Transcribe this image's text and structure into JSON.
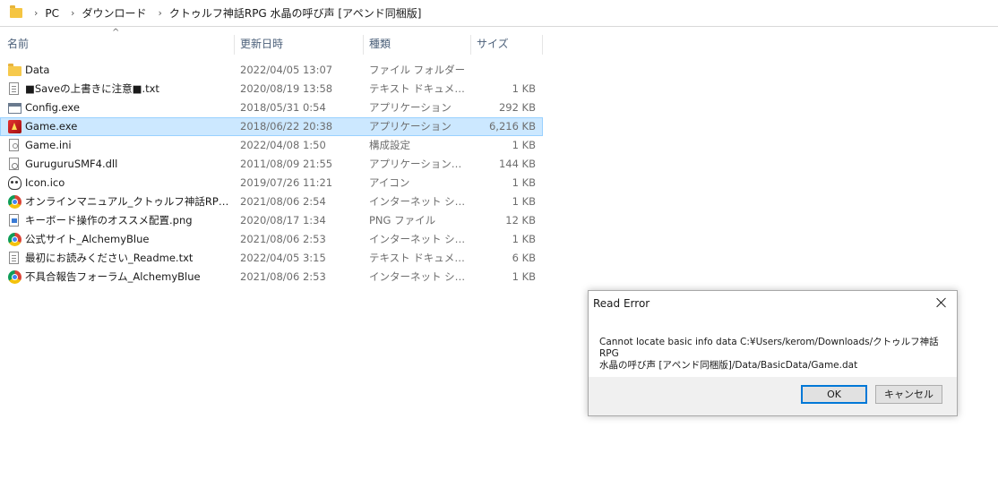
{
  "address_bar": {
    "folder_icon": "folder-icon",
    "breadcrumbs": [
      "PC",
      "ダウンロード",
      "クトゥルフ神話RPG 水晶の呼び声 [アペンド同梱版]"
    ]
  },
  "columns": {
    "name": "名前",
    "modified": "更新日時",
    "type": "種類",
    "size": "サイズ",
    "sort_indicator": "^"
  },
  "files": [
    {
      "name": "Data",
      "modified": "2022/04/05 13:07",
      "type": "ファイル フォルダー",
      "size": "",
      "icon": "folder-icon"
    },
    {
      "name": "■Saveの上書きに注意■.txt",
      "modified": "2020/08/19 13:58",
      "type": "テキスト ドキュメント",
      "size": "1 KB",
      "icon": "text-file-icon"
    },
    {
      "name": "Config.exe",
      "modified": "2018/05/31 0:54",
      "type": "アプリケーション",
      "size": "292 KB",
      "icon": "application-icon"
    },
    {
      "name": "Game.exe",
      "modified": "2018/06/22 20:38",
      "type": "アプリケーション",
      "size": "6,216 KB",
      "icon": "game-exe-icon",
      "selected": true
    },
    {
      "name": "Game.ini",
      "modified": "2022/04/08 1:50",
      "type": "構成設定",
      "size": "1 KB",
      "icon": "settings-file-icon"
    },
    {
      "name": "GuruguruSMF4.dll",
      "modified": "2011/08/09 21:55",
      "type": "アプリケーション拡張",
      "size": "144 KB",
      "icon": "dll-file-icon"
    },
    {
      "name": "Icon.ico",
      "modified": "2019/07/26 11:21",
      "type": "アイコン",
      "size": "1 KB",
      "icon": "skull-icon"
    },
    {
      "name": "オンラインマニュアル_クトゥルフ神話RPG_水晶...",
      "modified": "2021/08/06 2:54",
      "type": "インターネット ショート...",
      "size": "1 KB",
      "icon": "chrome-shortcut-icon"
    },
    {
      "name": "キーボード操作のオススメ配置.png",
      "modified": "2020/08/17 1:34",
      "type": "PNG ファイル",
      "size": "12 KB",
      "icon": "png-file-icon"
    },
    {
      "name": "公式サイト_AlchemyBlue",
      "modified": "2021/08/06 2:53",
      "type": "インターネット ショート...",
      "size": "1 KB",
      "icon": "chrome-shortcut-icon"
    },
    {
      "name": "最初にお読みください_Readme.txt",
      "modified": "2022/04/05 3:15",
      "type": "テキスト ドキュメント",
      "size": "6 KB",
      "icon": "text-file-icon"
    },
    {
      "name": "不具合報告フォーラム_AlchemyBlue",
      "modified": "2021/08/06 2:53",
      "type": "インターネット ショート...",
      "size": "1 KB",
      "icon": "chrome-shortcut-icon"
    }
  ],
  "dialog": {
    "title": "Read Error",
    "message_line1": "Cannot locate basic info data C:¥Users/kerom/Downloads/クトゥルフ神話RPG",
    "message_line2": "水晶の呼び声 [アペンド同梱版]/Data/BasicData/Game.dat",
    "ok_label": "OK",
    "cancel_label": "キャンセル",
    "close_icon": "close-icon"
  }
}
